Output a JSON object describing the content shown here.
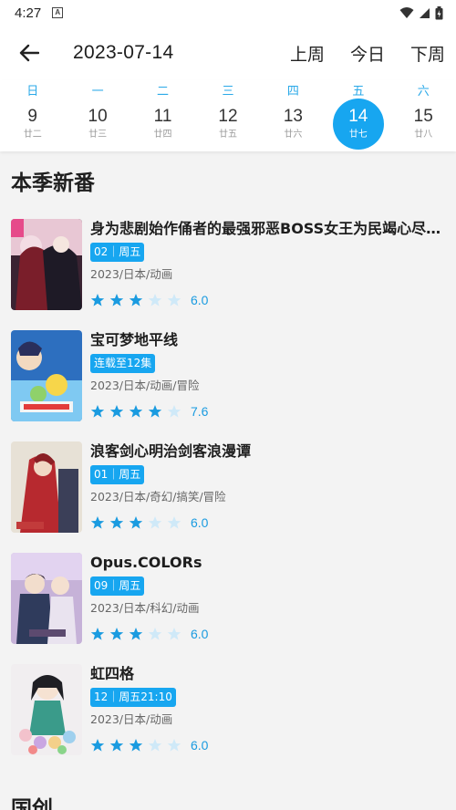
{
  "status": {
    "time": "4:27",
    "notif": "A"
  },
  "appbar": {
    "date": "2023-07-14",
    "actions": [
      "上周",
      "今日",
      "下周"
    ]
  },
  "week": [
    {
      "wk": "日",
      "num": "9",
      "lunar": "廿二"
    },
    {
      "wk": "一",
      "num": "10",
      "lunar": "廿三"
    },
    {
      "wk": "二",
      "num": "11",
      "lunar": "廿四"
    },
    {
      "wk": "三",
      "num": "12",
      "lunar": "廿五"
    },
    {
      "wk": "四",
      "num": "13",
      "lunar": "廿六"
    },
    {
      "wk": "五",
      "num": "14",
      "lunar": "廿七",
      "active": true
    },
    {
      "wk": "六",
      "num": "15",
      "lunar": "廿八"
    }
  ],
  "section1": "本季新番",
  "items": [
    {
      "title": "身为悲剧始作俑者的最强邪恶BOSS女王为民竭心尽…",
      "tag": "02｜周五",
      "meta": "2023/日本/动画",
      "stars": 3,
      "score": "6.0"
    },
    {
      "title": "宝可梦地平线",
      "tag": "连载至12集",
      "meta": "2023/日本/动画/冒险",
      "stars": 4,
      "score": "7.6"
    },
    {
      "title": "浪客剑心明治剑客浪漫谭",
      "tag": "01｜周五",
      "meta": "2023/日本/奇幻/搞笑/冒险",
      "stars": 3,
      "score": "6.0"
    },
    {
      "title": "Opus.COLORs",
      "tag": "09｜周五",
      "meta": "2023/日本/科幻/动画",
      "stars": 3,
      "score": "6.0"
    },
    {
      "title": "虹四格",
      "tag": "12｜周五21:10",
      "meta": "2023/日本/动画",
      "stars": 3,
      "score": "6.0"
    }
  ],
  "section2": "国创",
  "colors": {
    "accent": "#17a6f0",
    "star_on": "#1a9be0",
    "star_off": "#cfe9f8"
  }
}
